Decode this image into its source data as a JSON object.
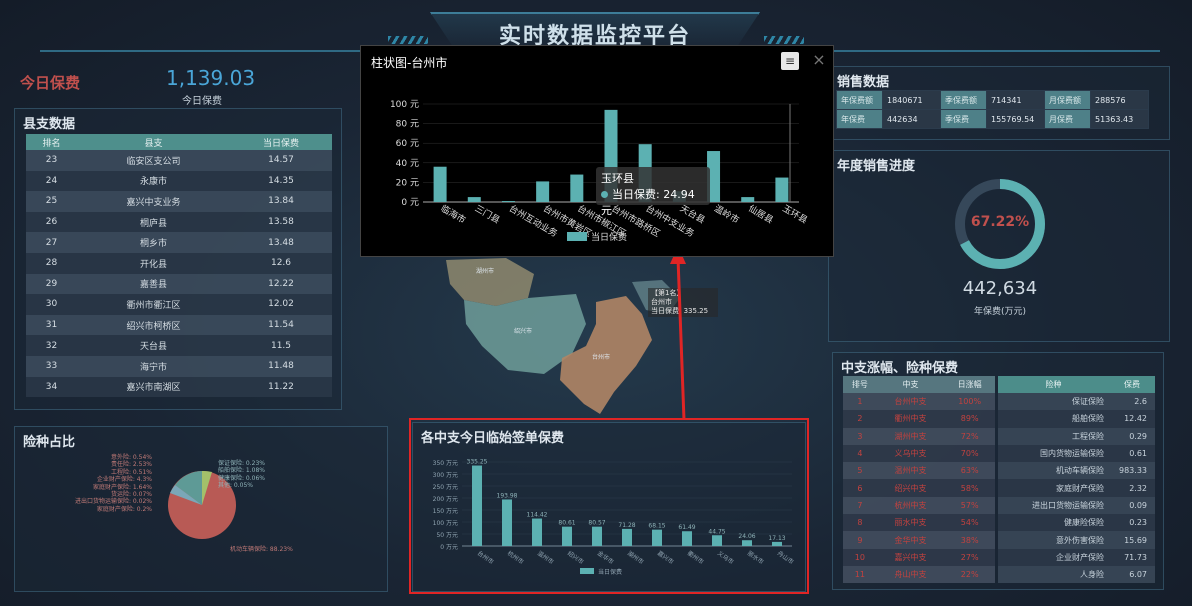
{
  "header": {
    "title": "实时数据监控平台"
  },
  "today": {
    "label": "今日保费",
    "value": "1,139.03",
    "sub_label": "今日保费"
  },
  "county_panel": {
    "title": "县支数据",
    "columns": [
      "排名",
      "县支",
      "当日保费"
    ],
    "rows": [
      [
        "23",
        "临安区支公司",
        "14.57"
      ],
      [
        "24",
        "永康市",
        "14.35"
      ],
      [
        "25",
        "嘉兴中支业务",
        "13.84"
      ],
      [
        "26",
        "桐庐县",
        "13.58"
      ],
      [
        "27",
        "桐乡市",
        "13.48"
      ],
      [
        "28",
        "开化县",
        "12.6"
      ],
      [
        "29",
        "嘉善县",
        "12.22"
      ],
      [
        "30",
        "衢州市衢江区",
        "12.02"
      ],
      [
        "31",
        "绍兴市柯桥区",
        "11.54"
      ],
      [
        "32",
        "天台县",
        "11.5"
      ],
      [
        "33",
        "海宁市",
        "11.48"
      ],
      [
        "34",
        "嘉兴市南湖区",
        "11.22"
      ]
    ]
  },
  "pie_panel": {
    "title": "险种占比",
    "labels_left": [
      "意外险: 0.54%",
      "责任险: 2.53%",
      "工程险: 0.51%",
      "企业财产保险: 4.3%",
      "家庭财产保险: 1.64%",
      "货运险: 0.07%",
      "进出口货物运输保险: 0.02%",
      "家庭财产保险: 0.2%"
    ],
    "labels_right": [
      "保证保险: 0.23%",
      "船舶保险: 1.08%",
      "健康保险: 0.06%",
      "其他: 0.05%"
    ],
    "label_bottom": "机动车辆保险: 88.23%"
  },
  "sales_panel": {
    "title": "销售数据",
    "rows": [
      [
        {
          "k": "年保费额",
          "v": "1840671"
        },
        {
          "k": "季保费额",
          "v": "714341"
        },
        {
          "k": "月保费额",
          "v": "288576"
        }
      ],
      [
        {
          "k": "年保费",
          "v": "442634"
        },
        {
          "k": "季保费",
          "v": "155769.54"
        },
        {
          "k": "月保费",
          "v": "51363.43"
        }
      ]
    ]
  },
  "progress_panel": {
    "title": "年度销售进度",
    "percent_label": "67.22%",
    "percent": 0.6722,
    "value": "442,634",
    "sub_label": "年保费(万元)"
  },
  "branch_panel": {
    "title": "中支涨幅、险种保费",
    "columns": [
      "排号",
      "中支",
      "日涨幅"
    ],
    "rows": [
      [
        "1",
        "台州中支",
        "100%"
      ],
      [
        "2",
        "衢州中支",
        "89%"
      ],
      [
        "3",
        "湖州中支",
        "72%"
      ],
      [
        "4",
        "义乌中支",
        "70%"
      ],
      [
        "5",
        "温州中支",
        "63%"
      ],
      [
        "6",
        "绍兴中支",
        "58%"
      ],
      [
        "7",
        "杭州中支",
        "57%"
      ],
      [
        "8",
        "丽水中支",
        "54%"
      ],
      [
        "9",
        "金华中支",
        "38%"
      ],
      [
        "10",
        "嘉兴中支",
        "27%"
      ],
      [
        "11",
        "舟山中支",
        "22%"
      ]
    ],
    "ins_columns": [
      "险种",
      "保费"
    ],
    "ins_rows": [
      [
        "保证保险",
        "2.6"
      ],
      [
        "船舶保险",
        "12.42"
      ],
      [
        "工程保险",
        "0.29"
      ],
      [
        "国内货物运输保险",
        "0.61"
      ],
      [
        "机动车辆保险",
        "983.33"
      ],
      [
        "家庭财产保险",
        "2.32"
      ],
      [
        "进出口货物运输保险",
        "0.09"
      ],
      [
        "健康险保险",
        "0.23"
      ],
      [
        "意外伤害保险",
        "15.69"
      ],
      [
        "企业财产保险",
        "71.73"
      ],
      [
        "人身险",
        "6.07"
      ]
    ]
  },
  "map": {
    "popup_lines": [
      "【第1名】",
      "台州市",
      "当日保费: 335.25"
    ],
    "regions": [
      "湖州市",
      "绍兴市",
      "台州市"
    ]
  },
  "popup": {
    "title": "柱状图-台州市",
    "menu_icon": "≡",
    "close_icon": "×",
    "legend": "当日保费",
    "tooltip_title": "玉环县",
    "tooltip_value": "当日保费: 24.94元"
  },
  "bottom_panel": {
    "title": "各中支今日临始签单保费",
    "legend": "当日保费"
  },
  "colors": {
    "bar": "#5cb1b2",
    "accent_red": "#c2423f",
    "highlight": "#e02525"
  },
  "chart_data": [
    {
      "type": "bar",
      "title": "柱状图-台州市",
      "categories": [
        "临海市",
        "三门县",
        "台州互动业务",
        "台州市黄岩区",
        "台州市椒江区",
        "台州市路桥区",
        "台州中支业务",
        "天台县",
        "温岭市",
        "仙居县",
        "玉环县"
      ],
      "series": [
        {
          "name": "当日保费",
          "values": [
            36,
            5,
            1,
            21,
            28,
            94,
            59,
            11,
            52,
            5,
            24.94
          ]
        }
      ],
      "ylim": [
        0,
        100
      ],
      "yticks": [
        "0 元",
        "20 元",
        "40 元",
        "60 元",
        "80 元",
        "100 元"
      ]
    },
    {
      "type": "bar",
      "title": "各中支今日临始签单保费",
      "categories": [
        "台州市",
        "杭州市",
        "温州市",
        "绍兴市",
        "金华市",
        "湖州市",
        "嘉兴市",
        "衢州市",
        "义乌市",
        "丽水市",
        "舟山市"
      ],
      "series": [
        {
          "name": "当日保费",
          "values": [
            335.25,
            193.98,
            114.42,
            80.61,
            80.57,
            71.28,
            68.15,
            61.49,
            44.75,
            24.06,
            17.13
          ]
        }
      ],
      "ylim": [
        0,
        350
      ],
      "yticks": [
        "0 万元",
        "50 万元",
        "100 万元",
        "150 万元",
        "200 万元",
        "250 万元",
        "300 万元",
        "350 万元"
      ]
    }
  ]
}
